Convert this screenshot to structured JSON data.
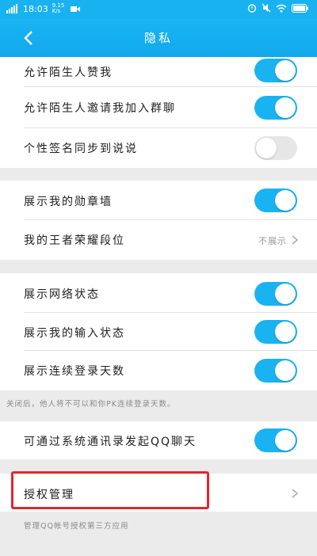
{
  "status": {
    "time": "18:03",
    "speed": "9.15 K/s"
  },
  "nav": {
    "title": "隐私"
  },
  "rows": {
    "allow_stranger_like": {
      "label": "允许陌生人赞我",
      "toggle": true
    },
    "allow_stranger_invite": {
      "label": "允许陌生人邀请我加入群聊",
      "toggle": true
    },
    "signature_sync": {
      "label": "个性签名同步到说说",
      "toggle": false
    },
    "show_badge": {
      "label": "展示我的勋章墙",
      "toggle": true
    },
    "kings_honor": {
      "label": "我的王者荣耀段位",
      "value": "不展示"
    },
    "show_network": {
      "label": "展示网络状态",
      "toggle": true
    },
    "show_typing": {
      "label": "展示我的输入状态",
      "toggle": true
    },
    "show_login_days": {
      "label": "展示连续登录天数",
      "toggle": true
    },
    "contacts_qq_chat": {
      "label": "可通过系统通讯录发起QQ聊天",
      "toggle": true
    },
    "auth_manage": {
      "label": "授权管理"
    }
  },
  "notes": {
    "login_days_note": "关闭后，他人将不可以和你PK连续登录天数。",
    "auth_note": "管理QQ帐号授权第三方应用"
  },
  "colors": {
    "accent": "#19b3f2",
    "highlight": "#e8242a",
    "background": "#ebebeb"
  }
}
